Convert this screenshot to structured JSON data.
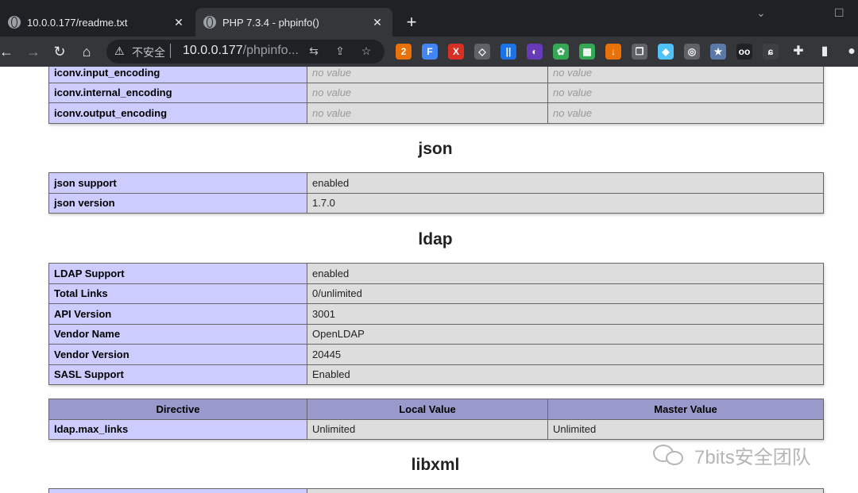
{
  "tabs": [
    {
      "title": "10.0.0.177/readme.txt"
    },
    {
      "title": "PHP 7.3.4 - phpinfo()"
    }
  ],
  "toolbar": {
    "insecure_label": "不安全",
    "url_host": "10.0.0.177",
    "url_path": "/phpinfo...",
    "extensions": [
      {
        "name": "ublock-icon",
        "text": "2",
        "color": "#e8710a"
      },
      {
        "name": "f-extension-icon",
        "text": "F",
        "color": "#4285f4"
      },
      {
        "name": "x-extension-icon",
        "text": "X",
        "color": "#d93025"
      },
      {
        "name": "eye-extension-icon",
        "text": "◇",
        "color": "#5f6368"
      },
      {
        "name": "bars-extension-icon",
        "text": "||",
        "color": "#1a73e8"
      },
      {
        "name": "moon-extension-icon",
        "text": "◐",
        "color": "#673ab7"
      },
      {
        "name": "gear-extension-icon",
        "text": "✿",
        "color": "#34a853"
      },
      {
        "name": "grid-extension-icon",
        "text": "▦",
        "color": "#34a853"
      },
      {
        "name": "download-extension-icon",
        "text": "↓",
        "color": "#e8710a"
      },
      {
        "name": "copy-extension-icon",
        "text": "❐",
        "color": "#5f6368"
      },
      {
        "name": "diamond-extension-icon",
        "text": "◆",
        "color": "#4fc3f7"
      },
      {
        "name": "camera-extension-icon",
        "text": "◎",
        "color": "#5f6368"
      },
      {
        "name": "star-extension-icon",
        "text": "★",
        "color": "#5c7aa8"
      },
      {
        "name": "mask-extension-icon",
        "text": "oo",
        "color": "#202124"
      },
      {
        "name": "shield-extension-icon",
        "text": "ɕ",
        "color": "#3c4043"
      }
    ]
  },
  "page": {
    "iconv_rows": [
      {
        "name": "iconv.input_encoding",
        "local": "no value",
        "master": "no value"
      },
      {
        "name": "iconv.internal_encoding",
        "local": "no value",
        "master": "no value"
      },
      {
        "name": "iconv.output_encoding",
        "local": "no value",
        "master": "no value"
      }
    ],
    "json": {
      "heading": "json",
      "rows": [
        {
          "name": "json support",
          "value": "enabled"
        },
        {
          "name": "json version",
          "value": "1.7.0"
        }
      ]
    },
    "ldap": {
      "heading": "ldap",
      "rows": [
        {
          "name": "LDAP Support",
          "value": "enabled"
        },
        {
          "name": "Total Links",
          "value": "0/unlimited"
        },
        {
          "name": "API Version",
          "value": "3001"
        },
        {
          "name": "Vendor Name",
          "value": "OpenLDAP"
        },
        {
          "name": "Vendor Version",
          "value": "20445"
        },
        {
          "name": "SASL Support",
          "value": "Enabled"
        }
      ],
      "directive_headers": [
        "Directive",
        "Local Value",
        "Master Value"
      ],
      "directives": [
        {
          "name": "ldap.max_links",
          "local": "Unlimited",
          "master": "Unlimited"
        }
      ]
    },
    "libxml": {
      "heading": "libxml"
    }
  },
  "watermark": {
    "text": "7bits安全团队"
  }
}
